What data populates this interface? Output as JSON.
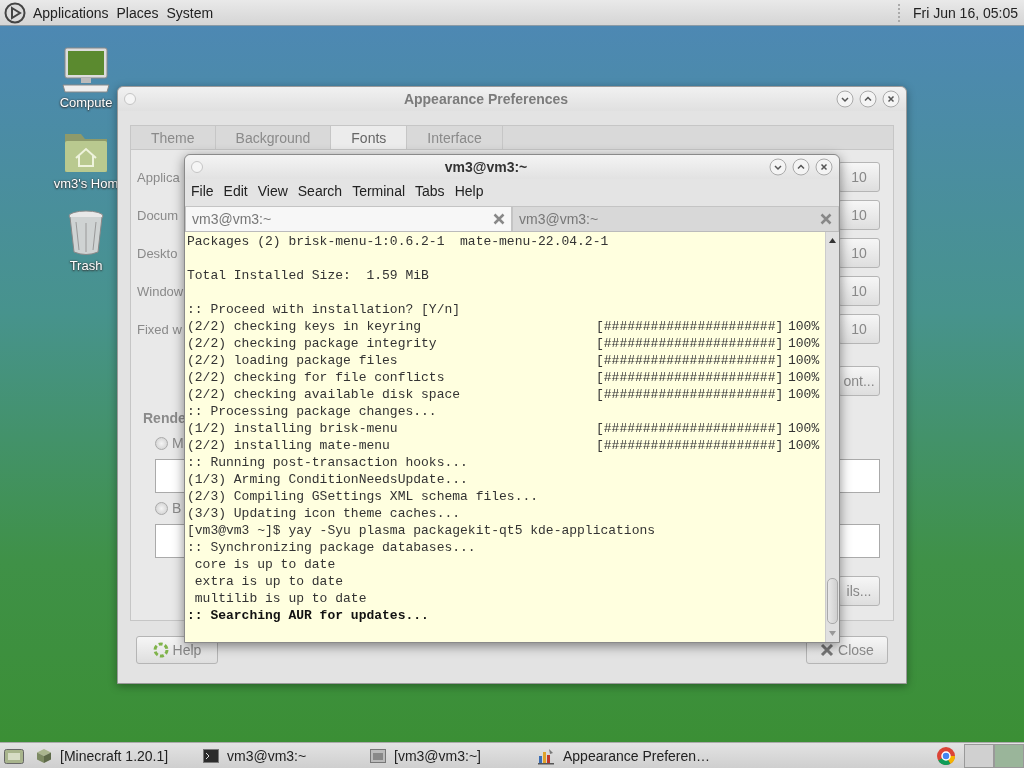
{
  "top_panel": {
    "menus": [
      "Applications",
      "Places",
      "System"
    ],
    "clock": "Fri Jun 16, 05:05"
  },
  "desktop_icons": [
    {
      "kind": "computer",
      "label": "Compute"
    },
    {
      "kind": "home",
      "label": "vm3's Hom"
    },
    {
      "kind": "trash",
      "label": "Trash"
    }
  ],
  "appearance_window": {
    "title": "Appearance Preferences",
    "tabs": [
      {
        "label": "Theme",
        "selected": false
      },
      {
        "label": "Background",
        "selected": false
      },
      {
        "label": "Fonts",
        "selected": true
      },
      {
        "label": "Interface",
        "selected": false
      }
    ],
    "font_rows": [
      {
        "label": "Applica",
        "size": "10"
      },
      {
        "label": "Docum",
        "size": "10"
      },
      {
        "label": "Deskto",
        "size": "10"
      },
      {
        "label": "Window",
        "size": "10"
      },
      {
        "label": "Fixed w",
        "size": "10"
      }
    ],
    "font_button": "ont...",
    "rendering_heading": "Rende",
    "rendering_options": [
      {
        "label": "M",
        "selected": false
      },
      {
        "label": "B",
        "selected": false
      }
    ],
    "details_button": "ils...",
    "buttons": [
      {
        "kind": "help",
        "label": "Help"
      },
      {
        "kind": "close",
        "label": "Close"
      }
    ]
  },
  "terminal": {
    "title": "vm3@vm3:~",
    "menu": [
      "File",
      "Edit",
      "View",
      "Search",
      "Terminal",
      "Tabs",
      "Help"
    ],
    "tabs": [
      {
        "label": "vm3@vm3:~",
        "selected": true
      },
      {
        "label": "vm3@vm3:~",
        "selected": false
      }
    ],
    "lines": [
      {
        "kind": "text",
        "text": "Packages (2) brisk-menu-1:0.6.2-1  mate-menu-22.04.2-1"
      },
      {
        "kind": "blank"
      },
      {
        "kind": "text",
        "text": "Total Installed Size:  1.59 MiB"
      },
      {
        "kind": "blank"
      },
      {
        "kind": "text",
        "text": ":: Proceed with installation? [Y/n]"
      },
      {
        "kind": "progress",
        "text": "(2/2) checking keys in keyring",
        "bar": "[######################]",
        "percent": "100%"
      },
      {
        "kind": "progress",
        "text": "(2/2) checking package integrity",
        "bar": "[######################]",
        "percent": "100%"
      },
      {
        "kind": "progress",
        "text": "(2/2) loading package files",
        "bar": "[######################]",
        "percent": "100%"
      },
      {
        "kind": "progress",
        "text": "(2/2) checking for file conflicts",
        "bar": "[######################]",
        "percent": "100%"
      },
      {
        "kind": "progress",
        "text": "(2/2) checking available disk space",
        "bar": "[######################]",
        "percent": "100%"
      },
      {
        "kind": "text",
        "text": ":: Processing package changes..."
      },
      {
        "kind": "progress",
        "text": "(1/2) installing brisk-menu",
        "bar": "[######################]",
        "percent": "100%"
      },
      {
        "kind": "progress",
        "text": "(2/2) installing mate-menu",
        "bar": "[######################]",
        "percent": "100%"
      },
      {
        "kind": "text",
        "text": ":: Running post-transaction hooks..."
      },
      {
        "kind": "text",
        "text": "(1/3) Arming ConditionNeedsUpdate..."
      },
      {
        "kind": "text",
        "text": "(2/3) Compiling GSettings XML schema files..."
      },
      {
        "kind": "text",
        "text": "(3/3) Updating icon theme caches..."
      },
      {
        "kind": "text",
        "text": "[vm3@vm3 ~]$ yay -Syu plasma packagekit-qt5 kde-applications"
      },
      {
        "kind": "text",
        "text": ":: Synchronizing package databases..."
      },
      {
        "kind": "text",
        "text": " core is up to date"
      },
      {
        "kind": "text",
        "text": " extra is up to date"
      },
      {
        "kind": "text",
        "text": " multilib is up to date"
      },
      {
        "kind": "bold",
        "text": ":: Searching AUR for updates..."
      }
    ]
  },
  "taskbar": {
    "items": [
      {
        "kind": "cube",
        "label": "[Minecraft 1.20.1]"
      },
      {
        "kind": "terminal",
        "label": "vm3@vm3:~"
      },
      {
        "kind": "window",
        "label": "[vm3@vm3:~]"
      },
      {
        "kind": "appearance",
        "label": "Appearance Preferen…"
      }
    ]
  }
}
